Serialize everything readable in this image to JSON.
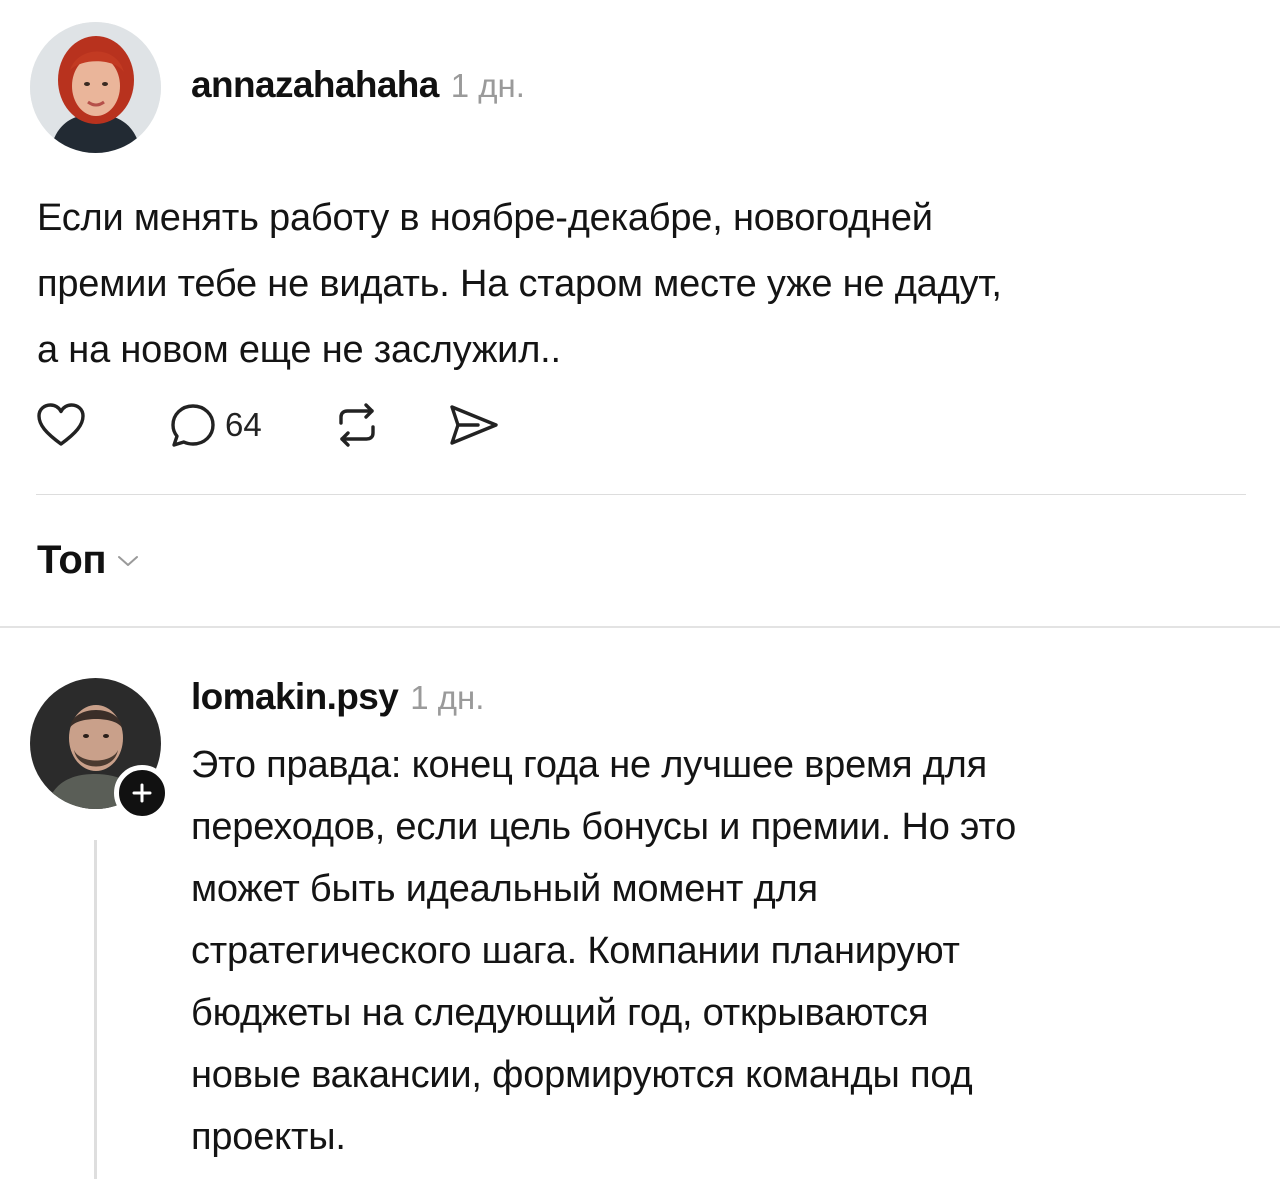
{
  "post": {
    "author": "annazahahaha",
    "time": "1 дн.",
    "avatar_icon": "woman-portrait-avatar",
    "text": "Если менять работу в ноябре-декабре, новогодней\nпремии тебе не видать. На старом месте уже не дадут,\nа на новом еще не заслужил..",
    "actions": {
      "like_icon": "heart-icon",
      "comment_icon": "speech-bubble-icon",
      "comment_count": "64",
      "repost_icon": "repost-icon",
      "share_icon": "send-icon"
    }
  },
  "comments_sort": {
    "label": "Топ",
    "icon": "chevron-down-icon"
  },
  "reply": {
    "author": "lomakin.psy",
    "time": "1 дн.",
    "avatar_icon": "man-portrait-avatar",
    "follow_icon": "plus-icon",
    "text": "Это правда: конец года не лучшее время для\nпереходов, если цель бонусы и премии. Но это\nможет быть идеальный момент для\nстратегического шага. Компании планируют\nбюджеты на следующий год, открываются\nновые вакансии, формируются команды под\nпроекты."
  },
  "colors": {
    "text": "#111111",
    "muted": "#9a9a9a",
    "divider": "#dddddd",
    "background": "#ffffff"
  }
}
